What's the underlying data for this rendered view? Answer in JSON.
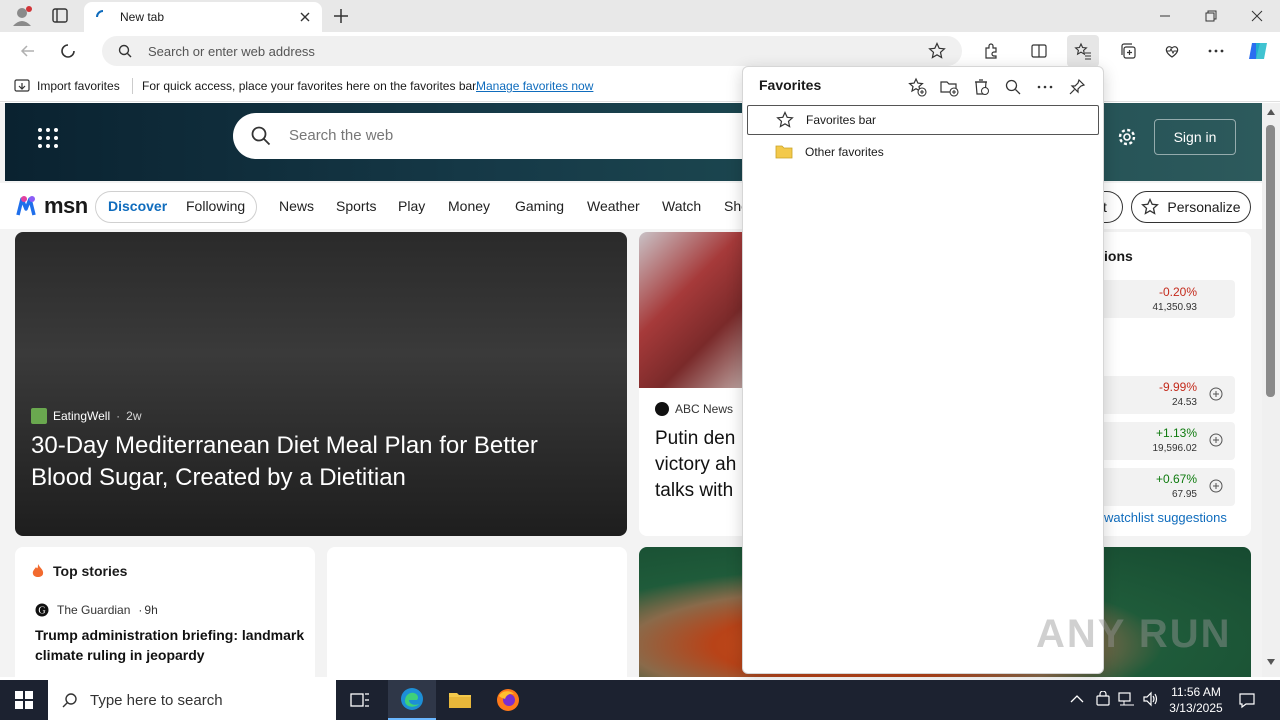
{
  "browser": {
    "tab_title": "New tab",
    "address_placeholder": "Search or enter web address"
  },
  "favorites_bar": {
    "import_label": "Import favorites",
    "hint_text": "For quick access, place your favorites here on the favorites bar.",
    "manage_link": "Manage favorites now"
  },
  "favorites_panel": {
    "title": "Favorites",
    "items": [
      {
        "label": "Favorites bar",
        "icon": "star-icon"
      },
      {
        "label": "Other favorites",
        "icon": "folder-icon"
      }
    ]
  },
  "msn": {
    "logo": "msn",
    "search_placeholder": "Search the web",
    "signin": "Sign in",
    "tabs": [
      "Discover",
      "Following"
    ],
    "nav": [
      "News",
      "Sports",
      "Play",
      "Money",
      "Gaming",
      "Weather",
      "Watch",
      "Sho"
    ],
    "partial_button": "ut",
    "personalize": "Personalize",
    "hero_card": {
      "source": "EatingWell",
      "age": "2w",
      "title": "30-Day Mediterranean Diet Meal Plan for Better Blood Sugar, Created by a Dietitian"
    },
    "mid_card": {
      "source": "ABC News",
      "title_lines": [
        "Putin den",
        "victory ah",
        "talks with"
      ]
    },
    "markets": {
      "heading_partial": "ions",
      "stocks": [
        {
          "change": "-0.20%",
          "value": "41,350.93",
          "dir": "neg"
        },
        {
          "change": "-9.99%",
          "value": "24.53",
          "dir": "neg"
        },
        {
          "change": "+1.13%",
          "value": "19,596.02",
          "dir": "pos"
        },
        {
          "change": "+0.67%",
          "value": "67.95",
          "dir": "pos"
        }
      ],
      "watchlist_link": "watchlist suggestions"
    },
    "top_stories": {
      "heading": "Top stories",
      "source": "The Guardian",
      "age": "9h",
      "headline": "Trump administration briefing: landmark climate ruling in jeopardy"
    }
  },
  "taskbar": {
    "search_placeholder": "Type here to search",
    "time": "11:56 AM",
    "date": "3/13/2025"
  },
  "watermark": "ANY RUN",
  "colors": {
    "accent": "#0f6cbd",
    "negative": "#c42b1c",
    "positive": "#0f7b0f",
    "taskbar": "#1c2230"
  }
}
